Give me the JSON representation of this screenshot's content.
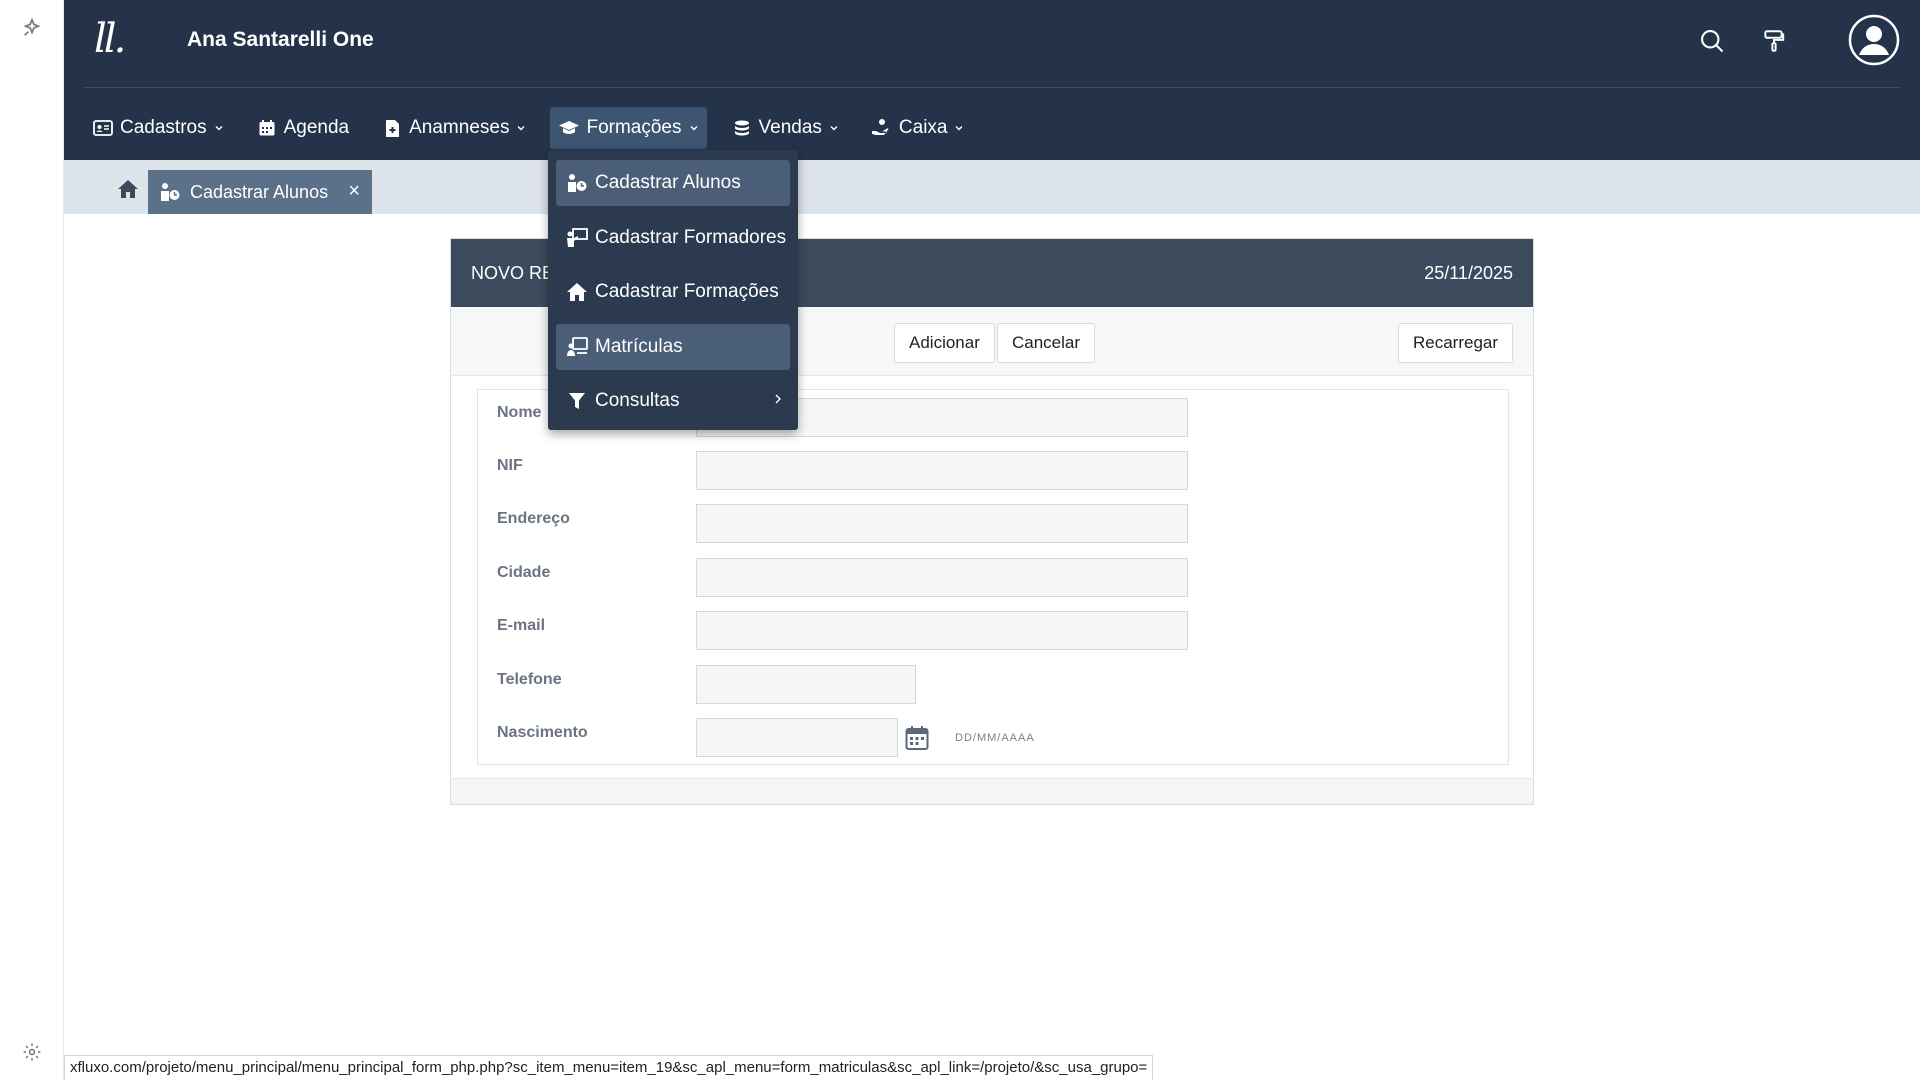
{
  "app": {
    "logo_text": "ll.",
    "title": "Ana Santarelli One"
  },
  "header": {
    "icons": [
      "search-icon",
      "paint-roller-icon",
      "user-avatar-icon"
    ]
  },
  "nav": {
    "items": [
      {
        "label": "Cadastros",
        "icon": "id-card-icon",
        "has_dropdown": true
      },
      {
        "label": "Agenda",
        "icon": "calendar-icon",
        "has_dropdown": false
      },
      {
        "label": "Anamneses",
        "icon": "file-medical-icon",
        "has_dropdown": true
      },
      {
        "label": "Formações",
        "icon": "graduation-cap-icon",
        "has_dropdown": true,
        "active": true
      },
      {
        "label": "Vendas",
        "icon": "coins-icon",
        "has_dropdown": true
      },
      {
        "label": "Caixa",
        "icon": "hand-holding-icon",
        "has_dropdown": true
      }
    ]
  },
  "dropdown": {
    "items": [
      {
        "label": "Cadastrar Alunos",
        "icon": "student-icon"
      },
      {
        "label": "Cadastrar Formadores",
        "icon": "teacher-icon"
      },
      {
        "label": "Cadastrar Formações",
        "icon": "home-icon"
      },
      {
        "label": "Matrículas",
        "icon": "enrollment-icon",
        "hovered": true
      },
      {
        "label": "Consultas",
        "icon": "filter-icon",
        "has_submenu": true
      }
    ]
  },
  "tabs": {
    "open": [
      {
        "label": "Cadastrar Alunos",
        "close": "×"
      }
    ]
  },
  "form": {
    "title": "NOVO RE",
    "date": "25/11/2025",
    "buttons": {
      "add": "Adicionar",
      "cancel": "Cancelar",
      "reload": "Recarregar"
    },
    "fields": [
      {
        "label": "Nome",
        "value": ""
      },
      {
        "label": "NIF",
        "value": ""
      },
      {
        "label": "Endereço",
        "value": ""
      },
      {
        "label": "Cidade",
        "value": ""
      },
      {
        "label": "E-mail",
        "value": ""
      },
      {
        "label": "Telefone",
        "value": ""
      },
      {
        "label": "Nascimento",
        "value": ""
      }
    ],
    "date_hint": "DD/MM/AAAA"
  },
  "status": {
    "url": "xfluxo.com/projeto/menu_principal/menu_principal_form_php.php?sc_item_menu=item_19&sc_apl_menu=form_matriculas&sc_apl_link=/projeto/&sc_usa_grupo="
  },
  "colors": {
    "header_bg": "#243349",
    "active_nav": "#3e5572",
    "dropdown_bg": "#2b3a4f",
    "dropdown_highlight": "#4a5e77",
    "tab_bg": "#5b7189",
    "panel_head": "#3c4a5c"
  }
}
